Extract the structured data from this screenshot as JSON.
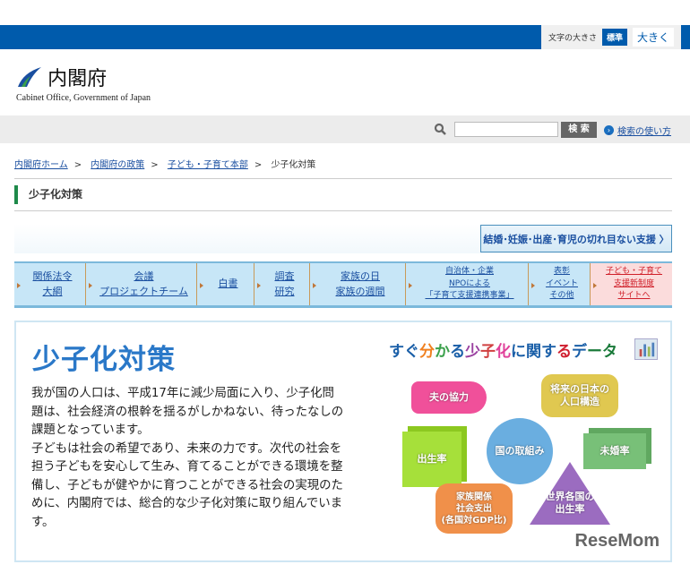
{
  "header": {
    "font_size_label": "文字の大きさ",
    "font_standard": "標準",
    "font_large": "大きく",
    "logo_jp": "内閣府",
    "logo_en": "Cabinet Office, Government of Japan"
  },
  "search": {
    "placeholder": "",
    "button": "検 索",
    "help": "検索の使い方"
  },
  "breadcrumb": [
    "内閣府ホーム",
    "内閣府の政策",
    "子ども・子育て本部",
    "少子化対策"
  ],
  "breadcrumb_sep": ">",
  "section_title": "少子化対策",
  "banner_button": "結婚･妊娠･出産･育児の切れ目ない支援 〉",
  "nav": [
    {
      "l1": "関係法令",
      "l2": "大綱"
    },
    {
      "l1": "会議",
      "l2": "プロジェクトチーム"
    },
    {
      "l1": "白書",
      "l2": ""
    },
    {
      "l1": "調査",
      "l2": "研究"
    },
    {
      "l1": "家族の日",
      "l2": "家族の週間"
    },
    {
      "l1": "自治体・企業",
      "l2": "NPOによる",
      "l3": "「子育て支援連携事業」"
    },
    {
      "l1": "表彰",
      "l2": "イベント",
      "l3": "その他"
    },
    {
      "l1": "子ども・子育て",
      "l2": "支援新制度",
      "l3": "サイトへ"
    }
  ],
  "main": {
    "title": "少子化対策",
    "paragraph1": "我が国の人口は、平成17年に減少局面に入り、少子化問題は、社会経済の根幹を揺るがしかねない、待ったなしの課題となっています。",
    "paragraph2": "子どもは社会の希望であり、未来の力です。次代の社会を担う子どもを安心して生み、育てることができる環境を整備し、子どもが健やかに育つことができる社会の実現のために、内閣府では、総合的な少子化対策に取り組んでいます。"
  },
  "data_section": {
    "title": "すぐ分かる少子化に関するデータ",
    "items": [
      "夫の協力",
      "将来の日本の人口構造",
      "国の取組み",
      "出生率",
      "未婚率",
      "世界各国の出生率",
      "家族関係社会支出(各国対GDP比)"
    ],
    "items_lines": [
      [
        "夫の協力"
      ],
      [
        "将来の日本の",
        "人口構造"
      ],
      [
        "国の取組み"
      ],
      [
        "出生率"
      ],
      [
        "未婚率"
      ],
      [
        "世界各国の",
        "出生率"
      ],
      [
        "家族関係",
        "社会支出",
        "(各国対GDP比)"
      ]
    ]
  },
  "colors": {
    "brand_blue": "#005bac",
    "accent_green": "#1e8a4a",
    "pink_nav": "#fbdcdc"
  },
  "watermark": "ReseMom"
}
